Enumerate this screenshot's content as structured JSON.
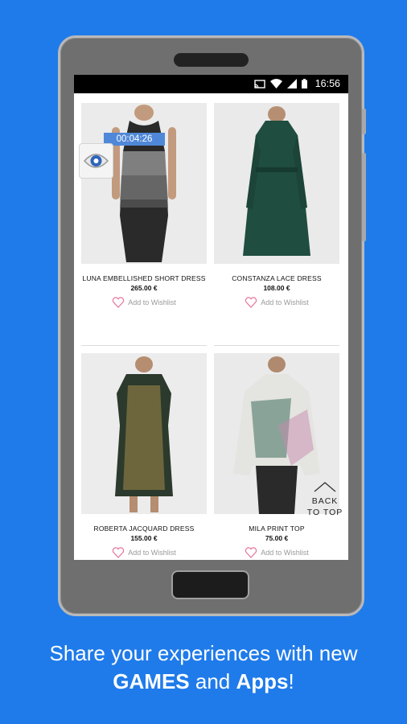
{
  "status_bar": {
    "time": "16:56"
  },
  "timer": "00:04:26",
  "products": [
    {
      "name": "LUNA EMBELLISHED SHORT DRESS",
      "price": "265.00 €",
      "wishlist": "Add to Wishlist"
    },
    {
      "name": "CONSTANZA LACE DRESS",
      "price": "108.00 €",
      "wishlist": "Add to Wishlist"
    },
    {
      "name": "ROBERTA JACQUARD DRESS",
      "price": "155.00 €",
      "wishlist": "Add to Wishlist"
    },
    {
      "name": "MILA PRINT TOP",
      "price": "75.00 €",
      "wishlist": "Add to Wishlist"
    }
  ],
  "back_to_top": {
    "line1": "BACK",
    "line2": "TO TOP"
  },
  "promo": {
    "line1": "Share your experiences with new",
    "games": "GAMES",
    "and": " and ",
    "apps": "Apps",
    "excl": "!"
  },
  "colors": {
    "background": "#1f7bea",
    "timer": "#4f88d8",
    "heart": "#e6739a"
  }
}
